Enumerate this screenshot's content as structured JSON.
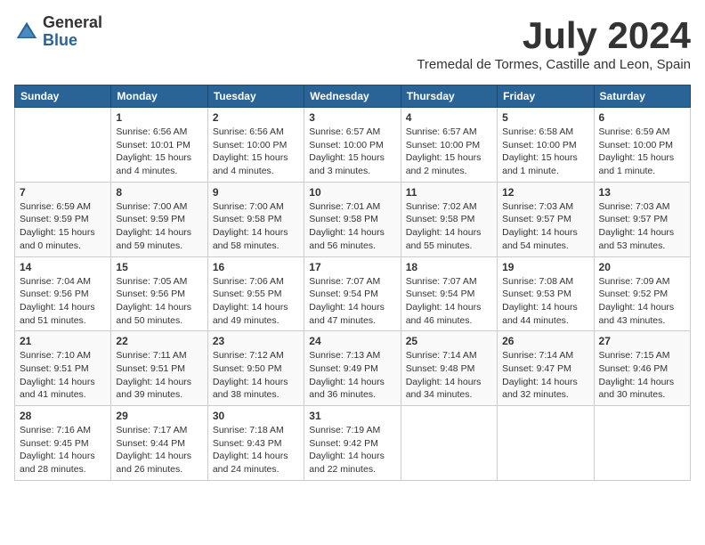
{
  "logo": {
    "general": "General",
    "blue": "Blue"
  },
  "title": "July 2024",
  "subtitle": "Tremedal de Tormes, Castille and Leon, Spain",
  "headers": [
    "Sunday",
    "Monday",
    "Tuesday",
    "Wednesday",
    "Thursday",
    "Friday",
    "Saturday"
  ],
  "weeks": [
    [
      {
        "day": "",
        "info": ""
      },
      {
        "day": "1",
        "info": "Sunrise: 6:56 AM\nSunset: 10:01 PM\nDaylight: 15 hours\nand 4 minutes."
      },
      {
        "day": "2",
        "info": "Sunrise: 6:56 AM\nSunset: 10:00 PM\nDaylight: 15 hours\nand 4 minutes."
      },
      {
        "day": "3",
        "info": "Sunrise: 6:57 AM\nSunset: 10:00 PM\nDaylight: 15 hours\nand 3 minutes."
      },
      {
        "day": "4",
        "info": "Sunrise: 6:57 AM\nSunset: 10:00 PM\nDaylight: 15 hours\nand 2 minutes."
      },
      {
        "day": "5",
        "info": "Sunrise: 6:58 AM\nSunset: 10:00 PM\nDaylight: 15 hours\nand 1 minute."
      },
      {
        "day": "6",
        "info": "Sunrise: 6:59 AM\nSunset: 10:00 PM\nDaylight: 15 hours\nand 1 minute."
      }
    ],
    [
      {
        "day": "7",
        "info": "Sunrise: 6:59 AM\nSunset: 9:59 PM\nDaylight: 15 hours\nand 0 minutes."
      },
      {
        "day": "8",
        "info": "Sunrise: 7:00 AM\nSunset: 9:59 PM\nDaylight: 14 hours\nand 59 minutes."
      },
      {
        "day": "9",
        "info": "Sunrise: 7:00 AM\nSunset: 9:58 PM\nDaylight: 14 hours\nand 58 minutes."
      },
      {
        "day": "10",
        "info": "Sunrise: 7:01 AM\nSunset: 9:58 PM\nDaylight: 14 hours\nand 56 minutes."
      },
      {
        "day": "11",
        "info": "Sunrise: 7:02 AM\nSunset: 9:58 PM\nDaylight: 14 hours\nand 55 minutes."
      },
      {
        "day": "12",
        "info": "Sunrise: 7:03 AM\nSunset: 9:57 PM\nDaylight: 14 hours\nand 54 minutes."
      },
      {
        "day": "13",
        "info": "Sunrise: 7:03 AM\nSunset: 9:57 PM\nDaylight: 14 hours\nand 53 minutes."
      }
    ],
    [
      {
        "day": "14",
        "info": "Sunrise: 7:04 AM\nSunset: 9:56 PM\nDaylight: 14 hours\nand 51 minutes."
      },
      {
        "day": "15",
        "info": "Sunrise: 7:05 AM\nSunset: 9:56 PM\nDaylight: 14 hours\nand 50 minutes."
      },
      {
        "day": "16",
        "info": "Sunrise: 7:06 AM\nSunset: 9:55 PM\nDaylight: 14 hours\nand 49 minutes."
      },
      {
        "day": "17",
        "info": "Sunrise: 7:07 AM\nSunset: 9:54 PM\nDaylight: 14 hours\nand 47 minutes."
      },
      {
        "day": "18",
        "info": "Sunrise: 7:07 AM\nSunset: 9:54 PM\nDaylight: 14 hours\nand 46 minutes."
      },
      {
        "day": "19",
        "info": "Sunrise: 7:08 AM\nSunset: 9:53 PM\nDaylight: 14 hours\nand 44 minutes."
      },
      {
        "day": "20",
        "info": "Sunrise: 7:09 AM\nSunset: 9:52 PM\nDaylight: 14 hours\nand 43 minutes."
      }
    ],
    [
      {
        "day": "21",
        "info": "Sunrise: 7:10 AM\nSunset: 9:51 PM\nDaylight: 14 hours\nand 41 minutes."
      },
      {
        "day": "22",
        "info": "Sunrise: 7:11 AM\nSunset: 9:51 PM\nDaylight: 14 hours\nand 39 minutes."
      },
      {
        "day": "23",
        "info": "Sunrise: 7:12 AM\nSunset: 9:50 PM\nDaylight: 14 hours\nand 38 minutes."
      },
      {
        "day": "24",
        "info": "Sunrise: 7:13 AM\nSunset: 9:49 PM\nDaylight: 14 hours\nand 36 minutes."
      },
      {
        "day": "25",
        "info": "Sunrise: 7:14 AM\nSunset: 9:48 PM\nDaylight: 14 hours\nand 34 minutes."
      },
      {
        "day": "26",
        "info": "Sunrise: 7:14 AM\nSunset: 9:47 PM\nDaylight: 14 hours\nand 32 minutes."
      },
      {
        "day": "27",
        "info": "Sunrise: 7:15 AM\nSunset: 9:46 PM\nDaylight: 14 hours\nand 30 minutes."
      }
    ],
    [
      {
        "day": "28",
        "info": "Sunrise: 7:16 AM\nSunset: 9:45 PM\nDaylight: 14 hours\nand 28 minutes."
      },
      {
        "day": "29",
        "info": "Sunrise: 7:17 AM\nSunset: 9:44 PM\nDaylight: 14 hours\nand 26 minutes."
      },
      {
        "day": "30",
        "info": "Sunrise: 7:18 AM\nSunset: 9:43 PM\nDaylight: 14 hours\nand 24 minutes."
      },
      {
        "day": "31",
        "info": "Sunrise: 7:19 AM\nSunset: 9:42 PM\nDaylight: 14 hours\nand 22 minutes."
      },
      {
        "day": "",
        "info": ""
      },
      {
        "day": "",
        "info": ""
      },
      {
        "day": "",
        "info": ""
      }
    ]
  ]
}
